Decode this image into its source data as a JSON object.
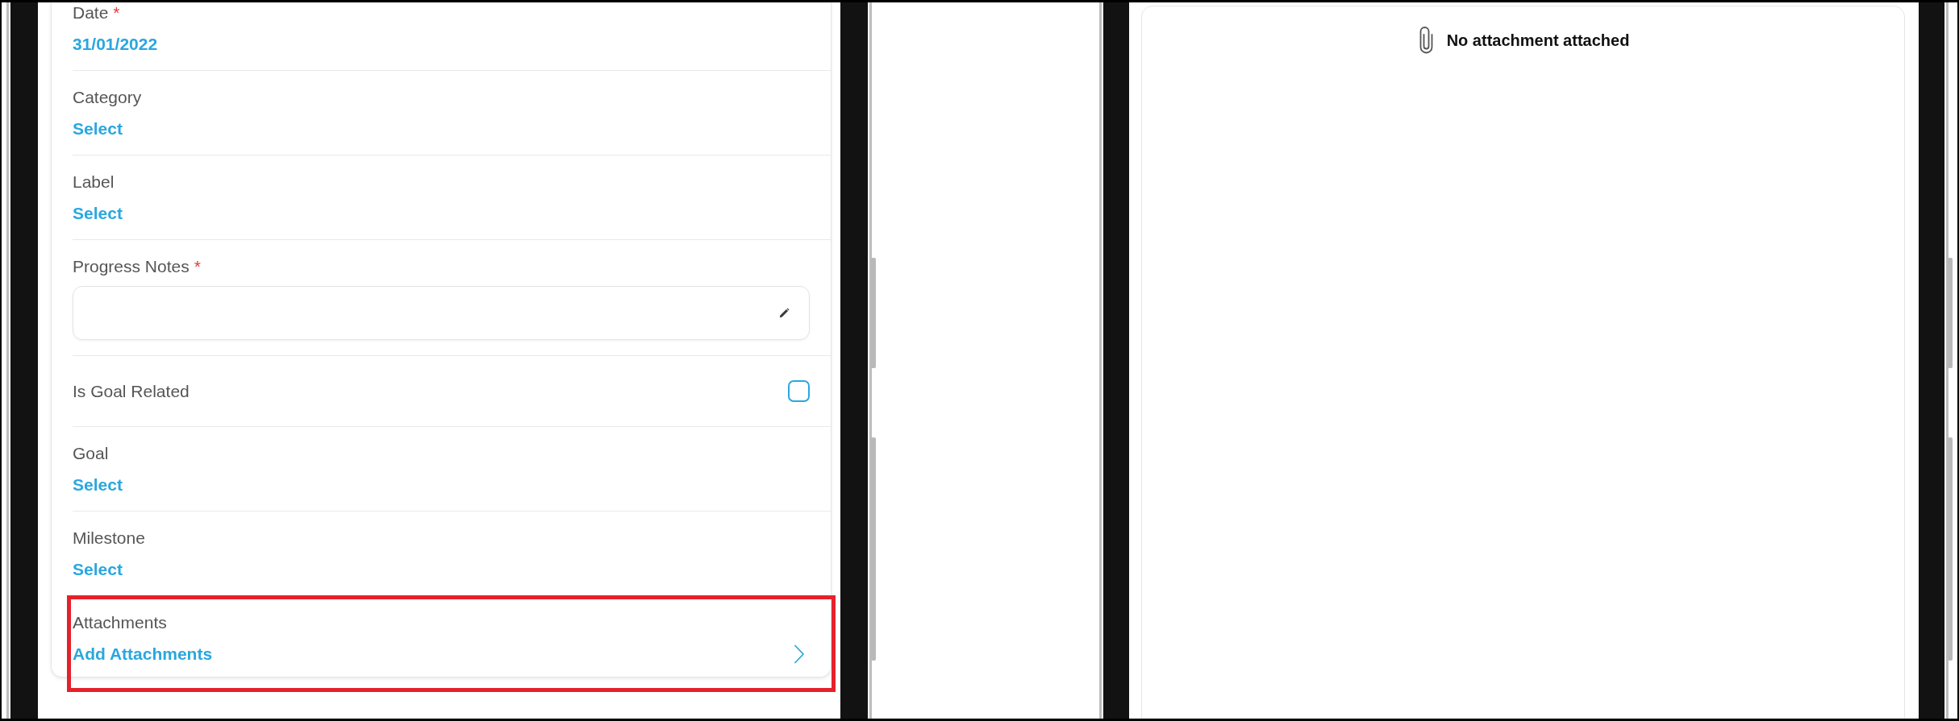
{
  "form": {
    "fields": [
      {
        "kind": "date",
        "label": "Date",
        "required_mark": "*",
        "value": "31/01/2022"
      },
      {
        "kind": "select",
        "label": "Category",
        "value": "Select"
      },
      {
        "kind": "select",
        "label": "Label",
        "value": "Select"
      },
      {
        "kind": "notes",
        "label": "Progress Notes",
        "required_mark": "*"
      },
      {
        "kind": "checkbox",
        "label": "Is Goal Related",
        "checked": false
      },
      {
        "kind": "select",
        "label": "Goal",
        "value": "Select"
      },
      {
        "kind": "select",
        "label": "Milestone",
        "value": "Select"
      },
      {
        "kind": "link",
        "label": "Attachments",
        "value": "Add Attachments",
        "highlighted": true
      }
    ]
  },
  "attachments_panel": {
    "message": "No attachment attached"
  }
}
